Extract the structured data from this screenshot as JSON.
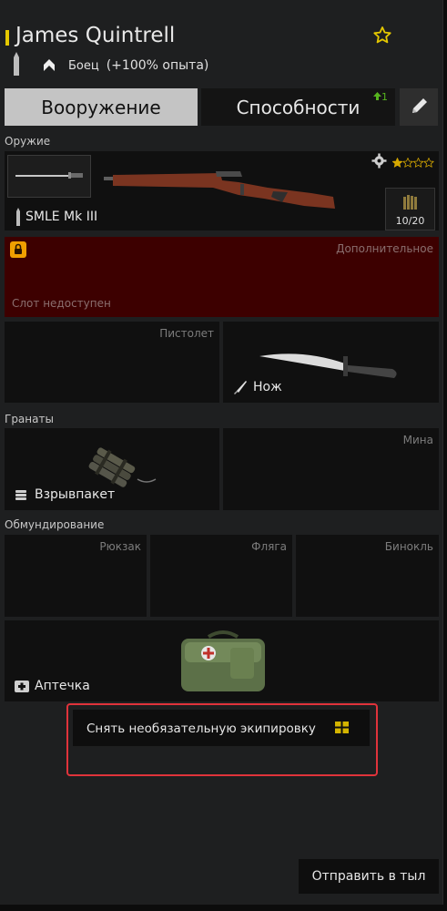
{
  "header": {
    "soldier_name": "James Quintrell",
    "rank": "Боец",
    "xp_bonus": "(+100% опыта)"
  },
  "tabs": {
    "weapons": "Вооружение",
    "abilities": "Способности",
    "abilities_badge": "1"
  },
  "sections": {
    "weapon": "Оружие",
    "grenades": "Гранаты",
    "equipment": "Обмундирование"
  },
  "primary_weapon": {
    "name": "SMLE Mk III",
    "ammo": "10/20",
    "stars_filled": 1,
    "stars_total": 4
  },
  "locked_slot": {
    "type": "Дополнительное",
    "status": "Слот недоступен"
  },
  "slots": {
    "pistol": {
      "type": "Пистолет"
    },
    "melee": {
      "name": "Нож"
    },
    "grenade": {
      "name": "Взрывпакет"
    },
    "mine": {
      "type": "Мина"
    },
    "backpack": {
      "type": "Рюкзак"
    },
    "flask": {
      "type": "Фляга"
    },
    "binoculars": {
      "type": "Бинокль"
    },
    "medkit": {
      "name": "Аптечка"
    }
  },
  "buttons": {
    "remove_optional": "Снять необязательную экипировку",
    "send_to_rear": "Отправить в тыл"
  },
  "colors": {
    "accent": "#e5c800",
    "locked_slot_bg": "#3d0000",
    "highlight_border": "#e0333b",
    "badge_green": "#56b41e"
  }
}
